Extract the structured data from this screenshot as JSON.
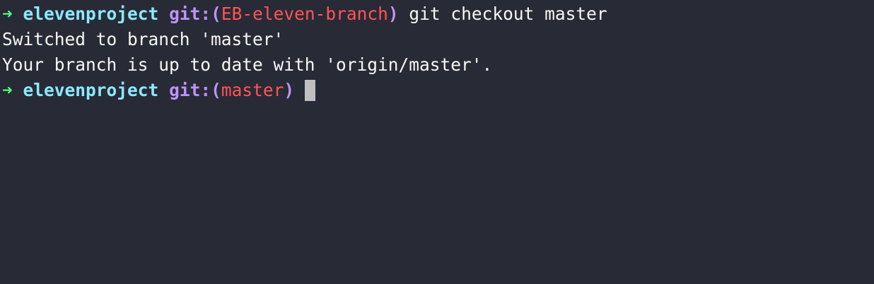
{
  "terminal": {
    "lines": [
      {
        "arrow": "➜",
        "dir": "elevenproject",
        "git_open": "git:(",
        "branch": "EB-eleven-branch",
        "git_close": ")",
        "command": "git checkout master"
      },
      {
        "text": "Switched to branch 'master'"
      },
      {
        "text": "Your branch is up to date with 'origin/master'."
      },
      {
        "arrow": "➜",
        "dir": "elevenproject",
        "git_open": "git:(",
        "branch": "master",
        "git_close": ")",
        "command": ""
      }
    ],
    "colors": {
      "background": "#282a36",
      "arrow": "#50fa7b",
      "directory": "#8be9fd",
      "git": "#bd93f9",
      "branch": "#ff5555",
      "text": "#f8f8f2",
      "cursor": "#bfbfbf"
    }
  }
}
